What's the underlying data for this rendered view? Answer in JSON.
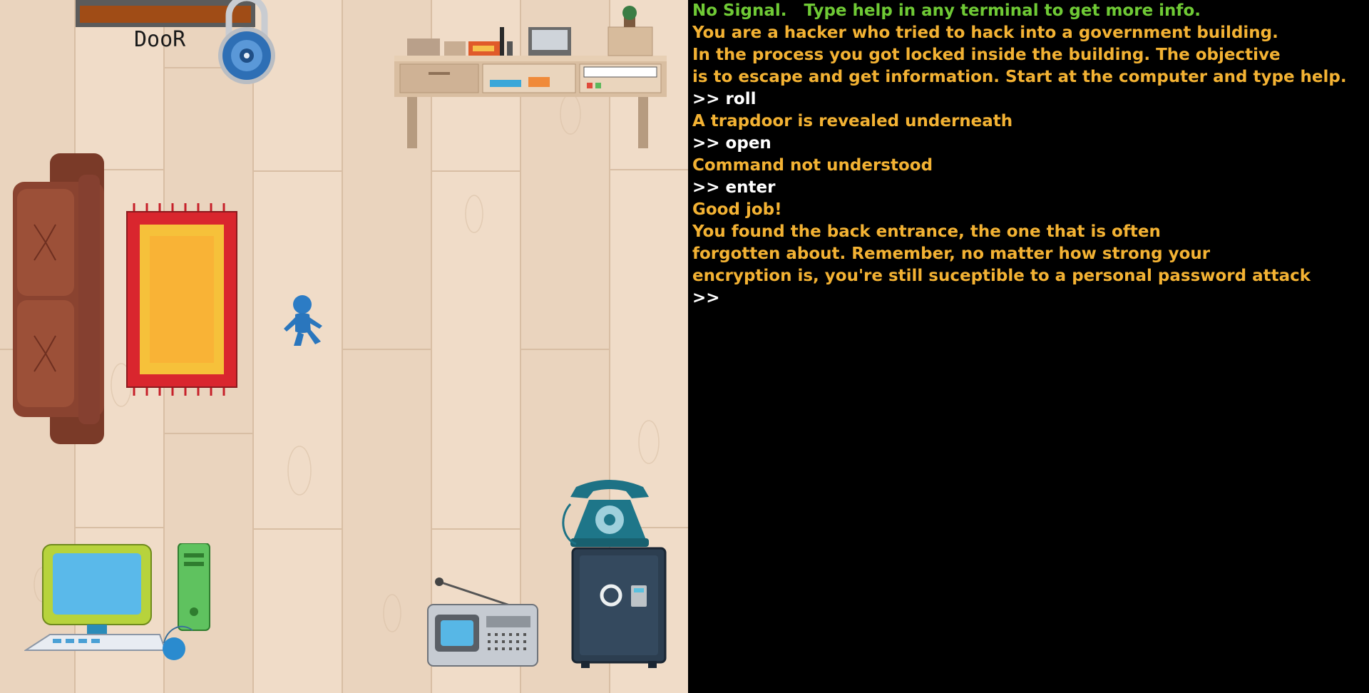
{
  "room": {
    "door_label": "DooR",
    "objects": [
      {
        "name": "door",
        "icon": "door-icon"
      },
      {
        "name": "padlock",
        "icon": "padlock-icon"
      },
      {
        "name": "desk",
        "icon": "desk-icon"
      },
      {
        "name": "sofa",
        "icon": "sofa-icon"
      },
      {
        "name": "rug",
        "icon": "rug-icon"
      },
      {
        "name": "player",
        "icon": "player-icon"
      },
      {
        "name": "computer",
        "icon": "computer-icon"
      },
      {
        "name": "radio",
        "icon": "radio-icon"
      },
      {
        "name": "telephone",
        "icon": "telephone-icon"
      },
      {
        "name": "safe",
        "icon": "safe-icon"
      }
    ]
  },
  "terminal": {
    "lines": [
      {
        "type": "status",
        "text": "No Signal.   Type help in any terminal to get more info."
      },
      {
        "type": "out",
        "text": "You are a hacker who tried to hack into a government building."
      },
      {
        "type": "out",
        "text": "In the process you got locked inside the building. The objective"
      },
      {
        "type": "out",
        "text": "is to escape and get information. Start at the computer and type help."
      },
      {
        "type": "cmd",
        "text": ">> roll"
      },
      {
        "type": "out",
        "text": "A trapdoor is revealed underneath"
      },
      {
        "type": "cmd",
        "text": ">> open"
      },
      {
        "type": "out",
        "text": "Command not understood"
      },
      {
        "type": "cmd",
        "text": ">> enter"
      },
      {
        "type": "out",
        "text": "Good job!"
      },
      {
        "type": "out",
        "text": "You found the back entrance, the one that is often"
      },
      {
        "type": "out",
        "text": "forgotten about. Remember, no matter how strong your"
      },
      {
        "type": "out",
        "text": "encryption is, you're still suceptible to a personal password attack"
      },
      {
        "type": "cmd",
        "text": ">>"
      }
    ]
  },
  "colors": {
    "floor": "#f0dcc8",
    "status_text": "#6fca35",
    "output_text": "#f3b233",
    "command_text": "#ffffff",
    "terminal_bg": "#000000"
  }
}
